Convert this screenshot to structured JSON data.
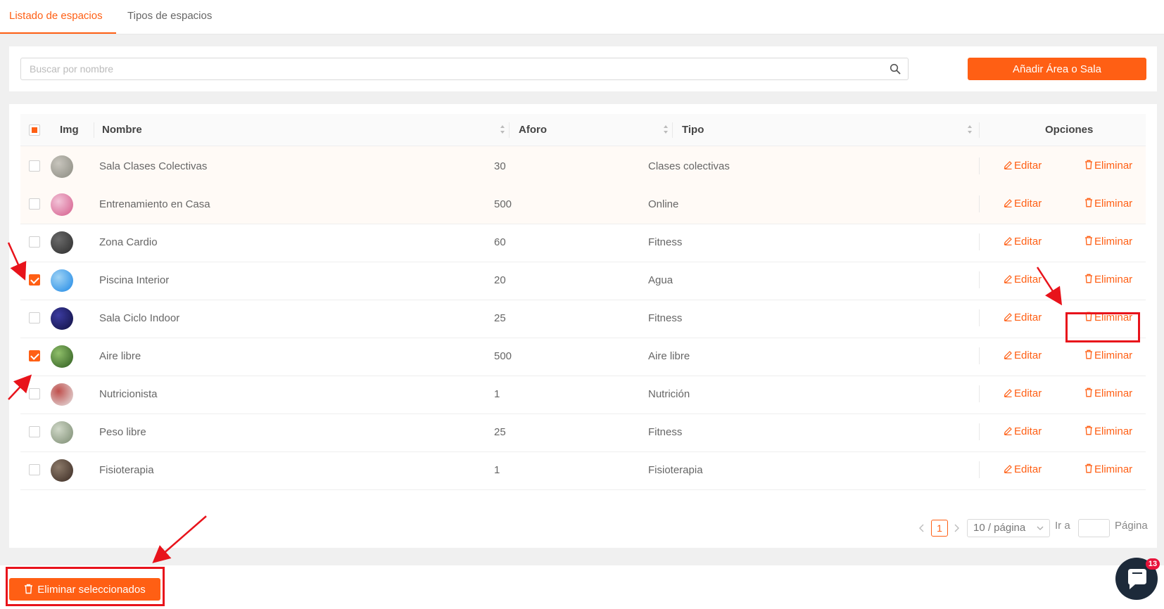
{
  "tabs": [
    {
      "label": "Listado de espacios",
      "active": true
    },
    {
      "label": "Tipos de espacios",
      "active": false
    }
  ],
  "search": {
    "placeholder": "Buscar por nombre",
    "value": ""
  },
  "add_button_label": "Añadir Área o Sala",
  "table": {
    "headers": {
      "img": "Img",
      "name": "Nombre",
      "capacity": "Aforo",
      "type": "Tipo",
      "options": "Opciones"
    },
    "rows": [
      {
        "name": "Sala Clases Colectivas",
        "capacity": "30",
        "type": "Clases colectivas",
        "checked": false,
        "edit": "Editar",
        "delete": "Eliminar"
      },
      {
        "name": "Entrenamiento en Casa",
        "capacity": "500",
        "type": "Online",
        "checked": false,
        "edit": "Editar",
        "delete": "Eliminar"
      },
      {
        "name": "Zona Cardio",
        "capacity": "60",
        "type": "Fitness",
        "checked": false,
        "edit": "Editar",
        "delete": "Eliminar"
      },
      {
        "name": "Piscina Interior",
        "capacity": "20",
        "type": "Agua",
        "checked": true,
        "edit": "Editar",
        "delete": "Eliminar"
      },
      {
        "name": "Sala Ciclo Indoor",
        "capacity": "25",
        "type": "Fitness",
        "checked": false,
        "edit": "Editar",
        "delete": "Eliminar"
      },
      {
        "name": "Aire libre",
        "capacity": "500",
        "type": "Aire libre",
        "checked": true,
        "edit": "Editar",
        "delete": "Eliminar"
      },
      {
        "name": "Nutricionista",
        "capacity": "1",
        "type": "Nutrición",
        "checked": false,
        "edit": "Editar",
        "delete": "Eliminar"
      },
      {
        "name": "Peso libre",
        "capacity": "25",
        "type": "Fitness",
        "checked": false,
        "edit": "Editar",
        "delete": "Eliminar"
      },
      {
        "name": "Fisioterapia",
        "capacity": "1",
        "type": "Fisioterapia",
        "checked": false,
        "edit": "Editar",
        "delete": "Eliminar"
      }
    ]
  },
  "pagination": {
    "current_page": "1",
    "page_size": "10 / página",
    "goto_label": "Ir a",
    "page_label": "Página"
  },
  "bulk_delete_label": "Eliminar seleccionados",
  "chat": {
    "badge_count": "13"
  },
  "colors": {
    "accent": "#ff5f14",
    "annotation_red": "#e8131b"
  }
}
